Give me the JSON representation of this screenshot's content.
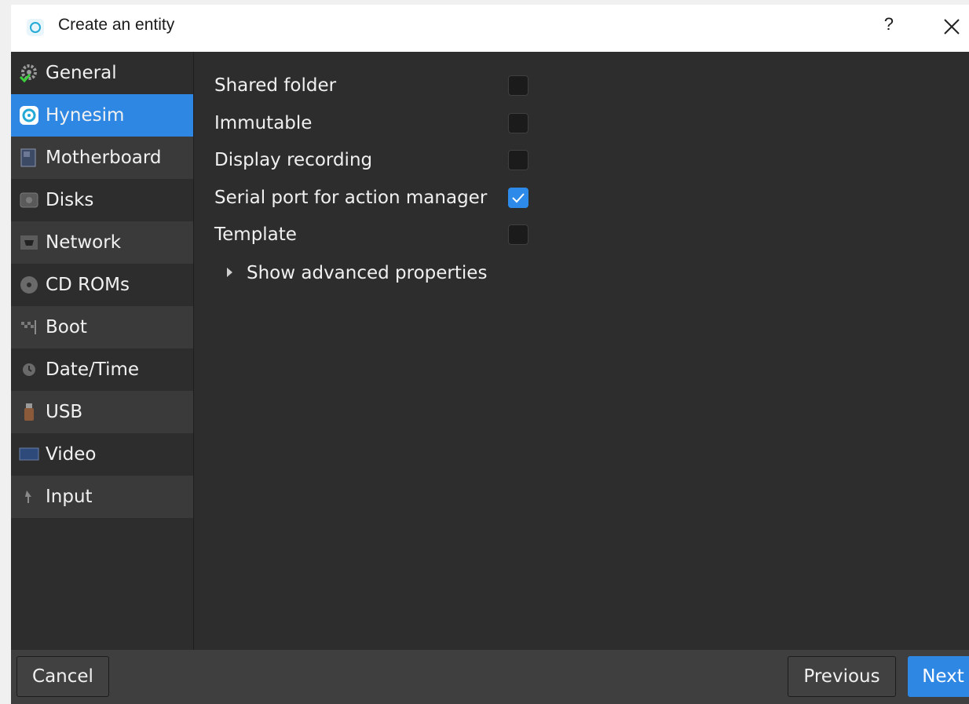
{
  "window": {
    "title": "Create an entity",
    "help_label": "?",
    "close_icon": "close-icon",
    "logo_icon": "hynesim-logo-icon"
  },
  "sidebar": {
    "items": [
      {
        "label": "General",
        "icon": "gear-check-icon"
      },
      {
        "label": "Hynesim",
        "icon": "hynesim-icon"
      },
      {
        "label": "Motherboard",
        "icon": "motherboard-icon"
      },
      {
        "label": "Disks",
        "icon": "disk-icon"
      },
      {
        "label": "Network",
        "icon": "network-card-icon"
      },
      {
        "label": "CD ROMs",
        "icon": "cd-icon"
      },
      {
        "label": "Boot",
        "icon": "boot-flag-icon"
      },
      {
        "label": "Date/Time",
        "icon": "clock-icon"
      },
      {
        "label": "USB",
        "icon": "usb-icon"
      },
      {
        "label": "Video",
        "icon": "monitor-icon"
      },
      {
        "label": "Input",
        "icon": "cursor-icon"
      }
    ],
    "active_item": "Hynesim"
  },
  "properties": [
    {
      "label": "Shared folder",
      "checked": false
    },
    {
      "label": "Immutable",
      "checked": false
    },
    {
      "label": "Display recording",
      "checked": false
    },
    {
      "label": "Serial port for action manager",
      "checked": true
    },
    {
      "label": "Template",
      "checked": false
    }
  ],
  "advanced": {
    "label": "Show advanced properties",
    "expanded": false
  },
  "footer": {
    "cancel_label": "Cancel",
    "previous_label": "Previous",
    "next_label": "Next"
  },
  "colors": {
    "accent": "#2f87e4",
    "panel_bg": "#2d2d2d",
    "footer_bg": "#3f3f3f"
  }
}
